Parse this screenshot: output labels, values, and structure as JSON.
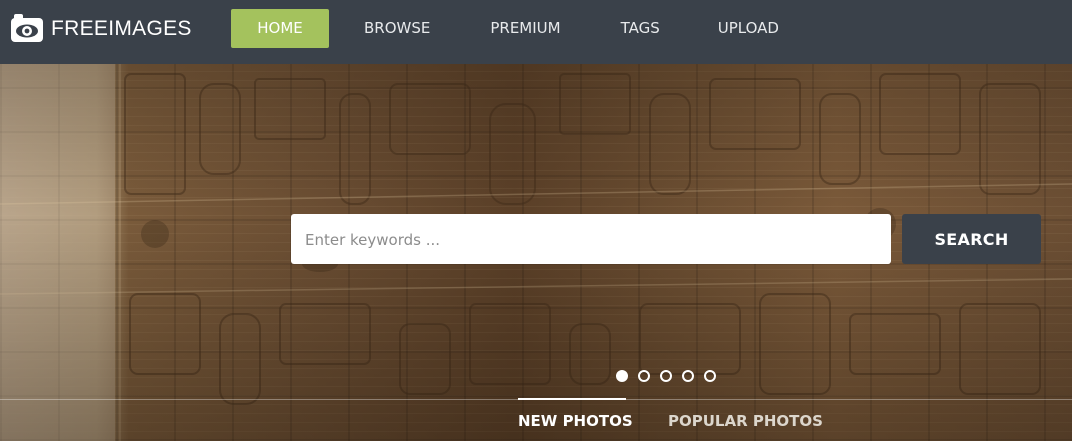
{
  "brand": {
    "name": "FREEIMAGES",
    "logo_icon": "camera-eye-icon"
  },
  "nav": {
    "items": [
      {
        "label": "HOME",
        "active": true
      },
      {
        "label": "BROWSE",
        "active": false
      },
      {
        "label": "PREMIUM",
        "active": false
      },
      {
        "label": "TAGS",
        "active": false
      },
      {
        "label": "UPLOAD",
        "active": false
      }
    ]
  },
  "search": {
    "placeholder": "Enter keywords ...",
    "value": "",
    "button_label": "SEARCH"
  },
  "carousel": {
    "slide_count": 5,
    "active_index": 0
  },
  "tabs": [
    {
      "label": "NEW PHOTOS",
      "active": true
    },
    {
      "label": "POPULAR PHOTOS",
      "active": false
    }
  ],
  "colors": {
    "header_bg": "#3a414a",
    "nav_active_bg": "#a4c25d",
    "search_button_bg": "#3a414a",
    "text_light": "#ffffff"
  }
}
